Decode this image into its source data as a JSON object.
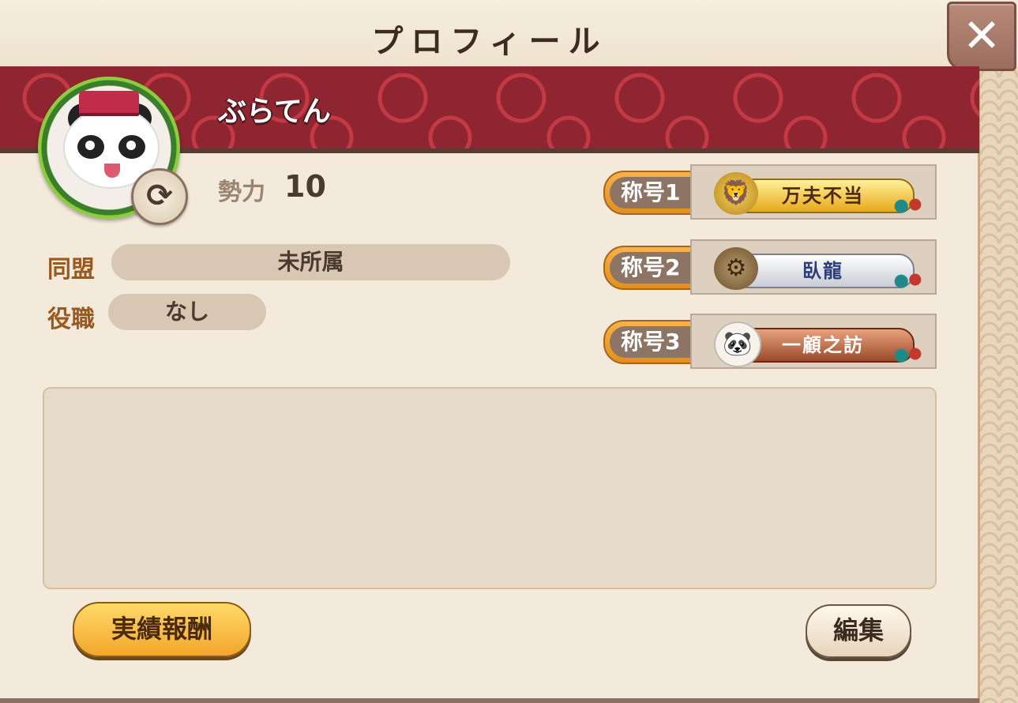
{
  "header": {
    "title": "プロフィール",
    "close_label": "✕"
  },
  "player": {
    "name": "ぶらてん",
    "power_label": "勢力",
    "power_value": "10",
    "refresh_icon": "⟳"
  },
  "fields": [
    {
      "label": "同盟",
      "value": "未所属"
    },
    {
      "label": "役職",
      "value": "なし"
    }
  ],
  "titles": [
    {
      "label": "称号1",
      "badge": "万夫不当",
      "icon": "lion-icon",
      "icon_glyph": "🦁",
      "style": "gold"
    },
    {
      "label": "称号2",
      "badge": "臥龍",
      "icon": "gear-icon",
      "icon_glyph": "⚙",
      "style": "silver"
    },
    {
      "label": "称号3",
      "badge": "一顧之訪",
      "icon": "panda-icon",
      "icon_glyph": "🐼",
      "style": "bronze"
    }
  ],
  "bio": {
    "text": ""
  },
  "buttons": {
    "achievements": "実績報酬",
    "edit": "編集"
  },
  "colors": {
    "band": "#8e2530",
    "gold": "#f3a62a",
    "panel": "#f3eadb"
  }
}
